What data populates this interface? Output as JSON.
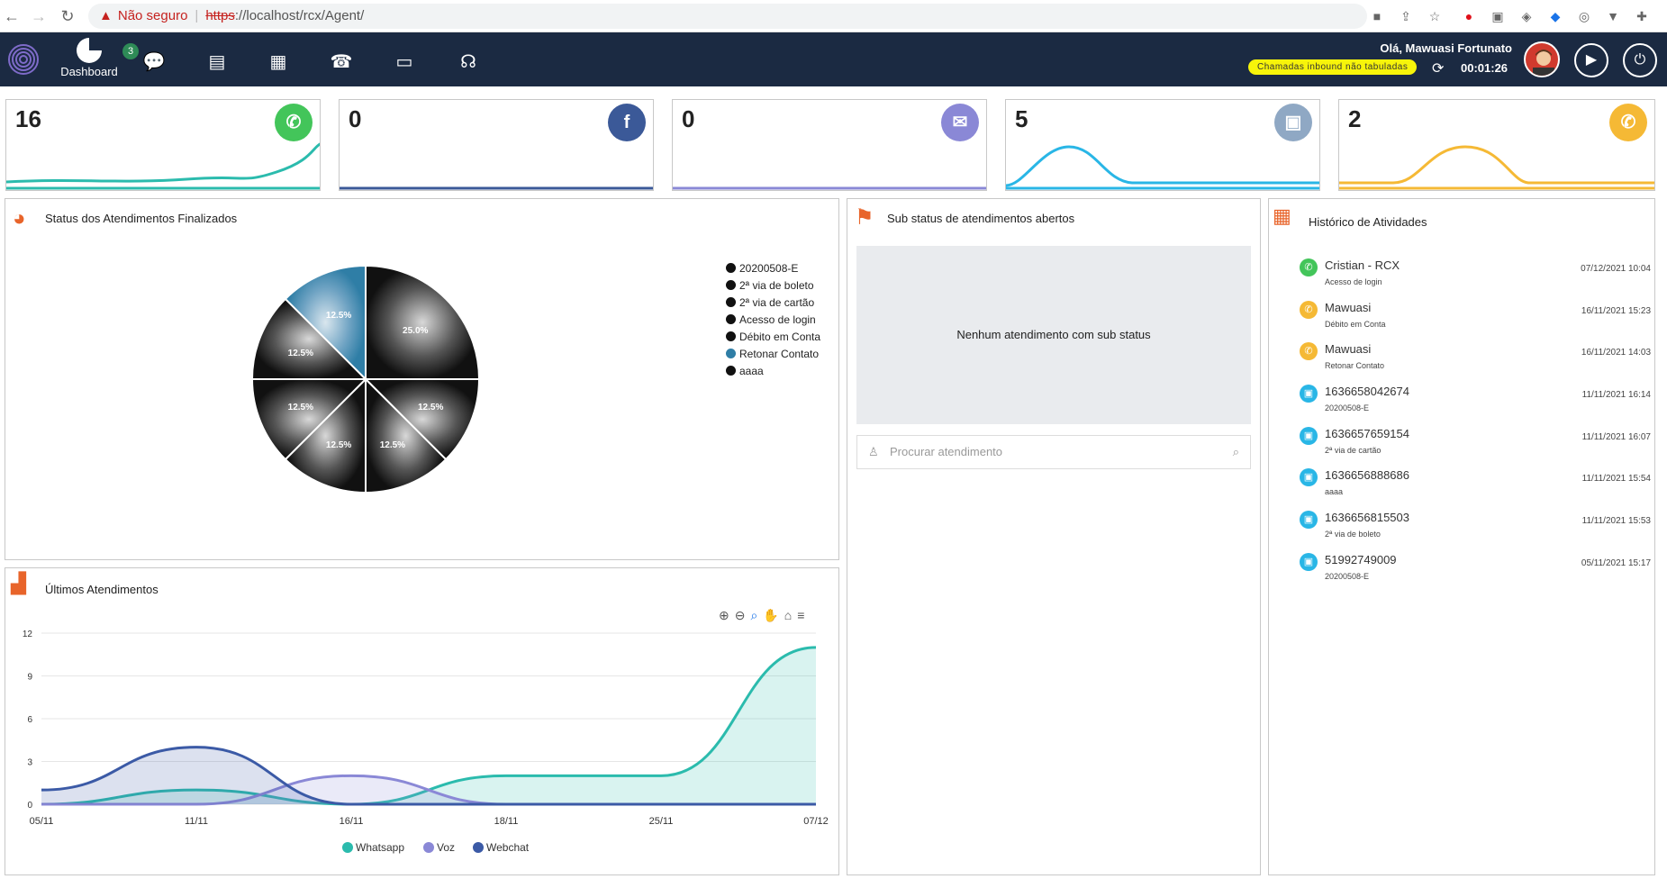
{
  "browser": {
    "warning_icon": "warning-triangle-icon",
    "insecure_label": "Não seguro",
    "url_scheme": "https",
    "url_rest": "://localhost/rcx/Agent/"
  },
  "topbar": {
    "nav_label": "Dashboard",
    "chat_badge": "3",
    "greeting": "Olá, Mawuasi Fortunato",
    "pill_text": "Chamadas inbound não tabuladas",
    "timer": "00:01:26",
    "bg_color": "#1b2a42"
  },
  "cards": [
    {
      "count": "16",
      "icon": "whatsapp-icon",
      "color": "#2bbbad"
    },
    {
      "count": "0",
      "icon": "facebook-icon",
      "color": "#3b5998"
    },
    {
      "count": "0",
      "icon": "mail-icon",
      "color": "#8a88d6"
    },
    {
      "count": "5",
      "icon": "webchat-icon",
      "color": "#29b6e6"
    },
    {
      "count": "2",
      "icon": "phone-icon",
      "color": "#f5b935"
    }
  ],
  "status_panel": {
    "title": "Status dos Atendimentos Finalizados",
    "legend": [
      "20200508-E",
      "2ª via de boleto",
      "2ª via de cartão",
      "Acesso de login",
      "Débito em Conta",
      "Retonar Contato",
      "aaaa"
    ]
  },
  "substatus_panel": {
    "title": "Sub status de atendimentos abertos",
    "empty_text": "Nenhum atendimento com sub status",
    "search_placeholder": "Procurar atendimento"
  },
  "history_panel": {
    "title": "Histórico de Atividades",
    "items": [
      {
        "icon": "whatsapp-icon",
        "name": "Cristian - RCX",
        "sub": "Acesso de login",
        "date": "07/12/2021 10:04"
      },
      {
        "icon": "phone-icon",
        "name": "Mawuasi",
        "sub": "Débito em Conta",
        "date": "16/11/2021 15:23"
      },
      {
        "icon": "phone-icon",
        "name": "Mawuasi",
        "sub": "Retonar Contato",
        "date": "16/11/2021 14:03"
      },
      {
        "icon": "webchat-icon",
        "name": "1636658042674",
        "sub": "20200508-E",
        "date": "11/11/2021 16:14"
      },
      {
        "icon": "webchat-icon",
        "name": "1636657659154",
        "sub": "2ª via de cartão",
        "date": "11/11/2021 16:07"
      },
      {
        "icon": "webchat-icon",
        "name": "1636656888686",
        "sub": "aaaa",
        "date": "11/11/2021 15:54"
      },
      {
        "icon": "webchat-icon",
        "name": "1636656815503",
        "sub": "2ª via de boleto",
        "date": "11/11/2021 15:53"
      },
      {
        "icon": "webchat-icon",
        "name": "51992749009",
        "sub": "20200508-E",
        "date": "05/11/2021 15:17"
      }
    ]
  },
  "recent_panel": {
    "title": "Últimos Atendimentos"
  },
  "chart_data": [
    {
      "type": "pie",
      "title": "Status dos Atendimentos Finalizados",
      "labels": [
        "20200508-E",
        "2ª via de boleto",
        "2ª via de cartão",
        "Acesso de login",
        "Débito em Conta",
        "Retonar Contato",
        "aaaa"
      ],
      "values": [
        25.0,
        12.5,
        12.5,
        12.5,
        12.5,
        12.5,
        12.5
      ],
      "highlight_color": "#2f7ea6"
    },
    {
      "type": "area",
      "title": "Últimos Atendimentos",
      "categories": [
        "05/11",
        "11/11",
        "16/11",
        "18/11",
        "25/11",
        "07/12"
      ],
      "ylim": [
        0,
        12
      ],
      "yticks": [
        0,
        3,
        6,
        9,
        12
      ],
      "series": [
        {
          "name": "Whatsapp",
          "color": "#2bbbad",
          "values": [
            0,
            1,
            0,
            2,
            2,
            11
          ]
        },
        {
          "name": "Voz",
          "color": "#8a88d6",
          "values": [
            0,
            0,
            2,
            0,
            0,
            0
          ]
        },
        {
          "name": "Webchat",
          "color": "#3b5aa6",
          "values": [
            1,
            4,
            0,
            0,
            0,
            0
          ]
        }
      ],
      "legend": "bottom"
    }
  ]
}
